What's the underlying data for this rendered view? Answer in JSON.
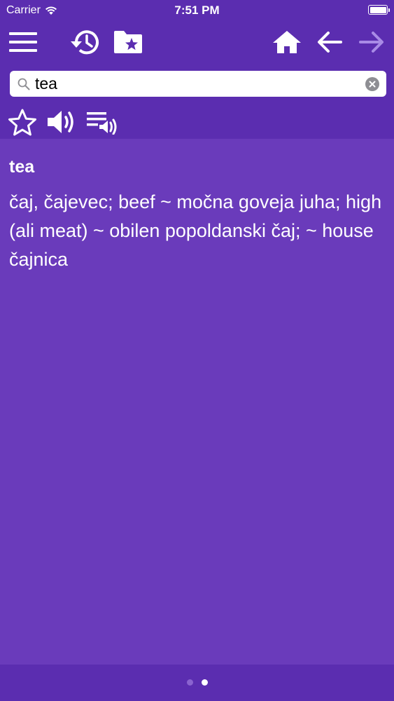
{
  "status_bar": {
    "carrier": "Carrier",
    "time": "7:51 PM"
  },
  "toolbar": {
    "icons": [
      "menu-icon",
      "history-icon",
      "favorites-folder-icon",
      "home-icon",
      "back-arrow-icon",
      "forward-arrow-icon"
    ]
  },
  "search": {
    "value": "tea",
    "placeholder": ""
  },
  "actions": {
    "icons": [
      "star-icon",
      "speaker-icon",
      "playlist-audio-icon"
    ]
  },
  "entry": {
    "headword": "tea",
    "definition": "čaj, čajevec; beef ~ močna goveja juha; high (ali meat) ~ obilen popoldanski čaj; ~ house čajnica"
  },
  "pager": {
    "page_count": 2,
    "active_index": 1
  },
  "colors": {
    "header_bg": "#5b2db0",
    "content_bg": "#6a3bbb",
    "disabled_icon": "#a98be6"
  }
}
